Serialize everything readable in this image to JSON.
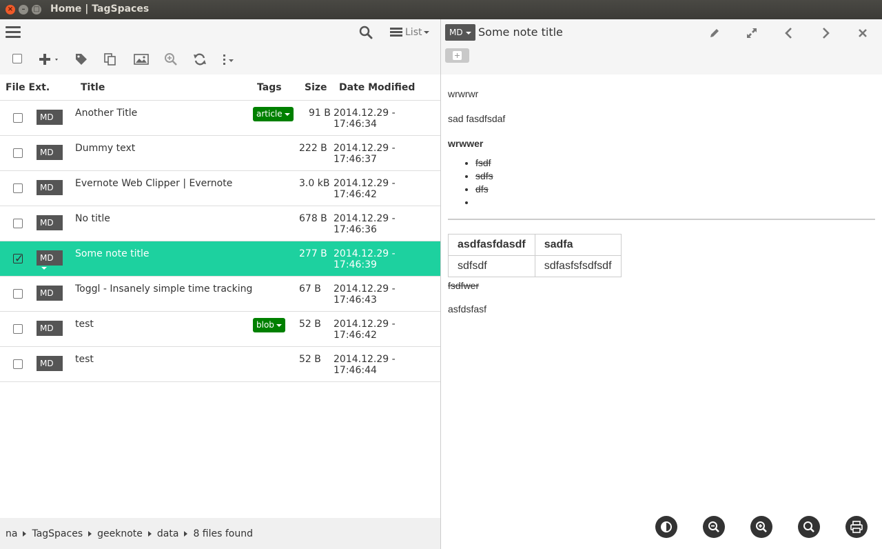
{
  "window": {
    "title": "Home | TagSpaces"
  },
  "toolbar": {
    "view_label": "List"
  },
  "table": {
    "headers": {
      "ext": "File Ext.",
      "title": "Title",
      "tags": "Tags",
      "size": "Size",
      "date": "Date Modified"
    },
    "rows": [
      {
        "ext": "MD",
        "title": "Another Title",
        "tag": "article",
        "size": "91 B",
        "date": "2014.12.29 - 17:46:34",
        "selected": false
      },
      {
        "ext": "MD",
        "title": "Dummy text",
        "tag": "",
        "size": "222 B",
        "date": "2014.12.29 - 17:46:37",
        "selected": false
      },
      {
        "ext": "MD",
        "title": "Evernote Web Clipper | Evernote",
        "tag": "",
        "size": "3.0 kB",
        "date": "2014.12.29 - 17:46:42",
        "selected": false
      },
      {
        "ext": "MD",
        "title": "No title",
        "tag": "",
        "size": "678 B",
        "date": "2014.12.29 - 17:46:36",
        "selected": false
      },
      {
        "ext": "MD",
        "title": "Some note title",
        "tag": "",
        "size": "277 B",
        "date": "2014.12.29 - 17:46:39",
        "selected": true
      },
      {
        "ext": "MD",
        "title": "Toggl - Insanely simple time tracking",
        "tag": "",
        "size": "67 B",
        "date": "2014.12.29 - 17:46:43",
        "selected": false
      },
      {
        "ext": "MD",
        "title": "test",
        "tag": "blob",
        "size": "52 B",
        "date": "2014.12.29 - 17:46:42",
        "selected": false
      },
      {
        "ext": "MD",
        "title": "test",
        "tag": "",
        "size": "52 B",
        "date": "2014.12.29 - 17:46:44",
        "selected": false
      }
    ]
  },
  "statusbar": {
    "crumbs": [
      "na",
      "TagSpaces",
      "geeknote",
      "data"
    ],
    "count": "8 files found"
  },
  "viewer": {
    "ext": "MD",
    "title": "Some note title",
    "content": {
      "p1": "wrwrwr",
      "p2": "sad fasdfsdaf",
      "h": "wrwwer",
      "list": [
        "fsdf",
        "sdfs",
        "dfs",
        ""
      ],
      "table_headers": [
        "asdfasfdasdf",
        "sadfa"
      ],
      "table_row": [
        "sdfsdf",
        "sdfasfsfsdfsdf"
      ],
      "strike": "fsdfwer",
      "last": "asfdsfasf"
    }
  },
  "colors": {
    "selected_row": "#1dd19f",
    "tag": "#008000",
    "badge": "#555555"
  }
}
